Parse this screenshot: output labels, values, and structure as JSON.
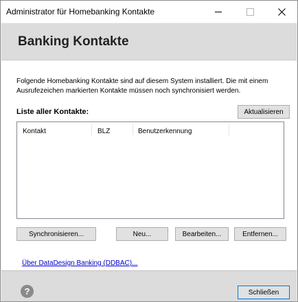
{
  "window": {
    "title": "Administrator für Homebanking Kontakte"
  },
  "header": {
    "title": "Banking Kontakte"
  },
  "content": {
    "description": "Folgende Homebanking Kontakte sind auf diesem System installiert. Die mit einem Ausrufezeichen markierten Kontakte müssen noch synchronisiert werden.",
    "list_label": "Liste aller Kontakte:",
    "refresh_label": "Aktualisieren",
    "columns": [
      "Kontakt",
      "BLZ",
      "Benutzerkennung"
    ],
    "rows": []
  },
  "actions": {
    "sync_label": "Synchronisieren...",
    "new_label": "Neu...",
    "edit_label": "Bearbeiten...",
    "remove_label": "Entfernen..."
  },
  "about_link": "Über DataDesign Banking (DDBAC)...",
  "footer": {
    "help_icon": "?",
    "close_label": "Schließen"
  }
}
